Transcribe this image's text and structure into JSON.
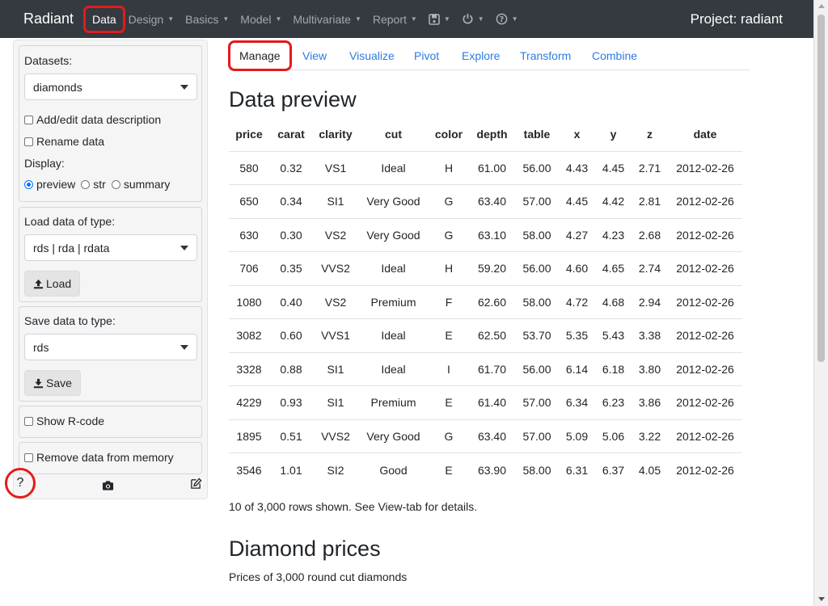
{
  "navbar": {
    "brand": "Radiant",
    "items": [
      {
        "label": "Data",
        "active": true
      },
      {
        "label": "Design"
      },
      {
        "label": "Basics"
      },
      {
        "label": "Model"
      },
      {
        "label": "Multivariate"
      },
      {
        "label": "Report"
      }
    ],
    "icons": [
      "save-icon",
      "power-icon",
      "help-circle-icon"
    ],
    "project": "Project: radiant"
  },
  "sidebar": {
    "datasets_label": "Datasets:",
    "datasets_value": "diamonds",
    "add_desc_label": "Add/edit data description",
    "rename_label": "Rename data",
    "display_label": "Display:",
    "display_options": [
      "preview",
      "str",
      "summary"
    ],
    "display_selected": "preview",
    "load_type_label": "Load data of type:",
    "load_type_value": "rds | rda | rdata",
    "load_button": "Load",
    "save_type_label": "Save data to type:",
    "save_type_value": "rds",
    "save_button": "Save",
    "show_rcode_label": "Show R-code",
    "remove_data_label": "Remove data from memory",
    "help_label": "?"
  },
  "tabs": [
    "Manage",
    "View",
    "Visualize",
    "Pivot",
    "Explore",
    "Transform",
    "Combine"
  ],
  "active_tab": "Manage",
  "main": {
    "preview_title": "Data preview",
    "columns": [
      "price",
      "carat",
      "clarity",
      "cut",
      "color",
      "depth",
      "table",
      "x",
      "y",
      "z",
      "date"
    ],
    "rows": [
      [
        "580",
        "0.32",
        "VS1",
        "Ideal",
        "H",
        "61.00",
        "56.00",
        "4.43",
        "4.45",
        "2.71",
        "2012-02-26"
      ],
      [
        "650",
        "0.34",
        "SI1",
        "Very Good",
        "G",
        "63.40",
        "57.00",
        "4.45",
        "4.42",
        "2.81",
        "2012-02-26"
      ],
      [
        "630",
        "0.30",
        "VS2",
        "Very Good",
        "G",
        "63.10",
        "58.00",
        "4.27",
        "4.23",
        "2.68",
        "2012-02-26"
      ],
      [
        "706",
        "0.35",
        "VVS2",
        "Ideal",
        "H",
        "59.20",
        "56.00",
        "4.60",
        "4.65",
        "2.74",
        "2012-02-26"
      ],
      [
        "1080",
        "0.40",
        "VS2",
        "Premium",
        "F",
        "62.60",
        "58.00",
        "4.72",
        "4.68",
        "2.94",
        "2012-02-26"
      ],
      [
        "3082",
        "0.60",
        "VVS1",
        "Ideal",
        "E",
        "62.50",
        "53.70",
        "5.35",
        "5.43",
        "3.38",
        "2012-02-26"
      ],
      [
        "3328",
        "0.88",
        "SI1",
        "Ideal",
        "I",
        "61.70",
        "56.00",
        "6.14",
        "6.18",
        "3.80",
        "2012-02-26"
      ],
      [
        "4229",
        "0.93",
        "SI1",
        "Premium",
        "E",
        "61.40",
        "57.00",
        "6.34",
        "6.23",
        "3.86",
        "2012-02-26"
      ],
      [
        "1895",
        "0.51",
        "VVS2",
        "Very Good",
        "G",
        "63.40",
        "57.00",
        "5.09",
        "5.06",
        "3.22",
        "2012-02-26"
      ],
      [
        "3546",
        "1.01",
        "SI2",
        "Good",
        "E",
        "63.90",
        "58.00",
        "6.31",
        "6.37",
        "4.05",
        "2012-02-26"
      ]
    ],
    "rows_note": "10 of 3,000 rows shown. See View-tab for details.",
    "description_title": "Diamond prices",
    "description_text": "Prices of 3,000 round cut diamonds"
  },
  "colors": {
    "navbar_bg": "#343a40",
    "link": "#2c7be5",
    "highlight": "#e41a1c"
  }
}
